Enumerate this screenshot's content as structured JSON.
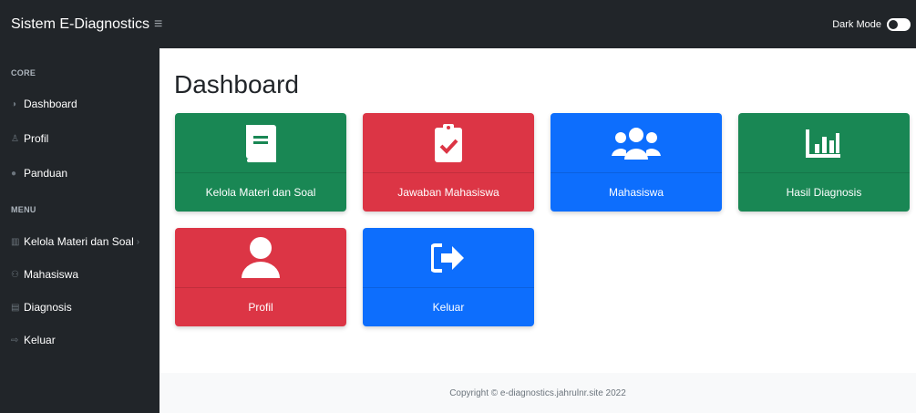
{
  "topbar": {
    "brand": "Sistem E-Diagnostics",
    "dark_mode_label": "Dark Mode"
  },
  "sidebar": {
    "headings": [
      "CORE",
      "MENU"
    ],
    "core_items": [
      {
        "label": "Dashboard",
        "icon": "tachometer-icon"
      },
      {
        "label": "Profil",
        "icon": "user-icon"
      },
      {
        "label": "Panduan",
        "icon": "info-icon"
      }
    ],
    "menu_items": [
      {
        "label": "Kelola Materi dan Soal",
        "icon": "columns-icon"
      },
      {
        "label": "Mahasiswa",
        "icon": "users-icon"
      },
      {
        "label": "Diagnosis",
        "icon": "chart-icon"
      },
      {
        "label": "Keluar",
        "icon": "sign-out-icon"
      }
    ]
  },
  "main": {
    "title": "Dashboard",
    "cards": [
      {
        "label": "Kelola Materi dan Soal",
        "color": "#198754",
        "icon": "book-icon"
      },
      {
        "label": "Jawaban Mahasiswa",
        "color": "#dc3545",
        "icon": "clipboard-check-icon"
      },
      {
        "label": "Mahasiswa",
        "color": "#0d6efd",
        "icon": "users-icon"
      },
      {
        "label": "Hasil Diagnosis",
        "color": "#198754",
        "icon": "chart-bar-icon"
      },
      {
        "label": "Profil",
        "color": "#dc3545",
        "icon": "user-icon"
      },
      {
        "label": "Keluar",
        "color": "#0d6efd",
        "icon": "sign-out-icon"
      }
    ]
  },
  "footer": {
    "text": "Copyright © e-diagnostics.jahrulnr.site 2022"
  }
}
